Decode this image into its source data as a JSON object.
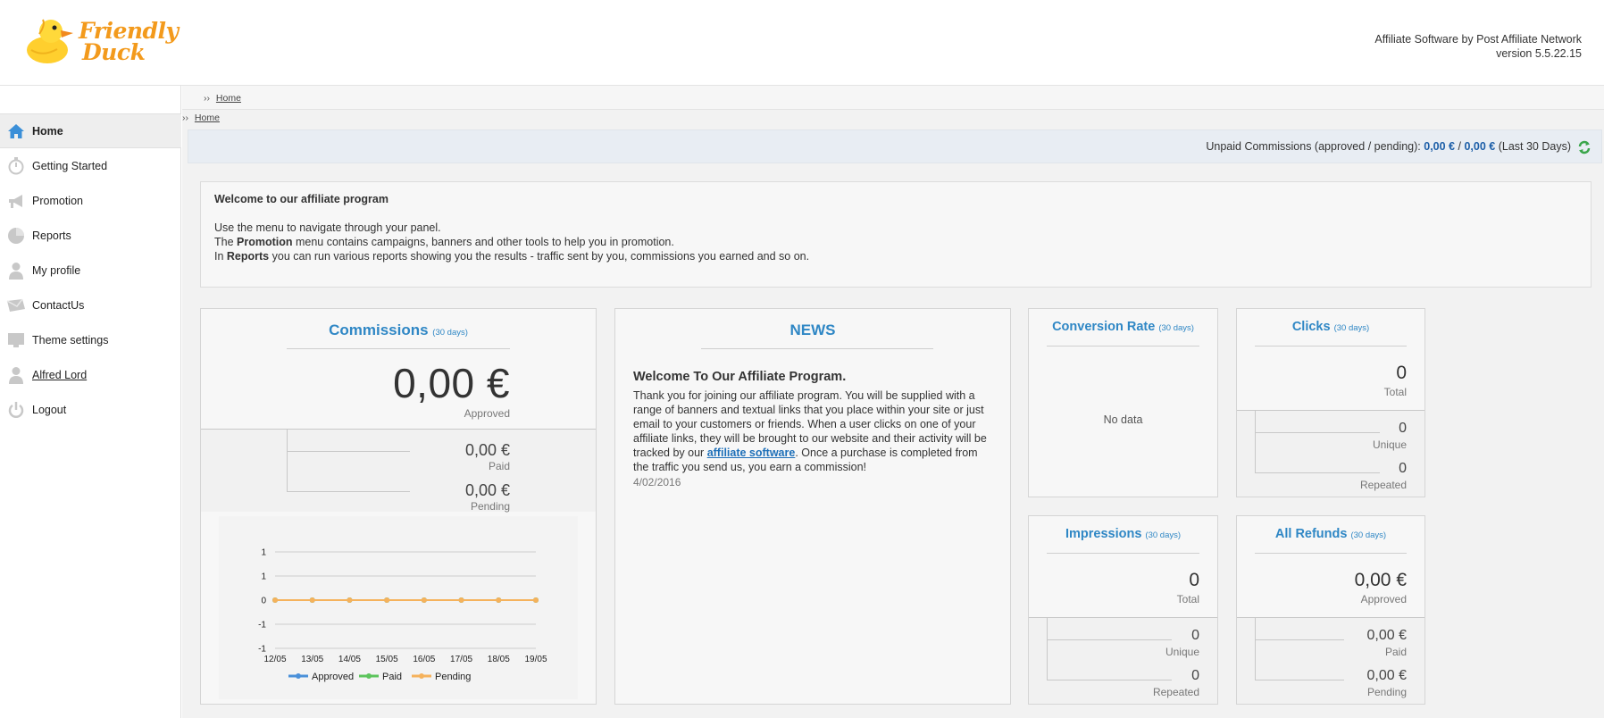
{
  "brand": {
    "logo_line1": "Friendly",
    "logo_line2": "Duck"
  },
  "header": {
    "software": "Affiliate Software by Post Affiliate Network",
    "version": "version 5.5.22.15"
  },
  "sidebar": {
    "items": [
      {
        "label": "Home",
        "icon": "home-icon",
        "active": true
      },
      {
        "label": "Getting Started",
        "icon": "stopwatch-icon"
      },
      {
        "label": "Promotion",
        "icon": "megaphone-icon"
      },
      {
        "label": "Reports",
        "icon": "pie-chart-icon"
      },
      {
        "label": "My profile",
        "icon": "user-icon"
      },
      {
        "label": "ContactUs",
        "icon": "envelope-icon"
      },
      {
        "label": "Theme settings",
        "icon": "monitor-icon"
      },
      {
        "label": "Alfred Lord",
        "icon": "user-icon"
      },
      {
        "label": "Logout",
        "icon": "power-icon"
      }
    ]
  },
  "breadcrumb": {
    "sep": "››",
    "home": "Home"
  },
  "unpaid": {
    "prefix": "Unpaid Commissions (approved / pending):",
    "approved": "0,00 €",
    "slash": "/",
    "pending": "0,00 €",
    "suffix": "(Last 30 Days)"
  },
  "welcome": {
    "title": "Welcome to our affiliate program",
    "line1": "Use the menu to navigate through your panel.",
    "line2_a": "The ",
    "line2_b": "Promotion",
    "line2_c": " menu contains campaigns, banners and other tools to help you in promotion.",
    "line3_a": "In ",
    "line3_b": "Reports",
    "line3_c": " you can run various reports showing you the results - traffic sent by you, commissions you earned and so on."
  },
  "commissions": {
    "title": "Commissions",
    "period": "(30 days)",
    "approved_value": "0,00 €",
    "approved_label": "Approved",
    "paid_value": "0,00 €",
    "paid_label": "Paid",
    "pending_value": "0,00 €",
    "pending_label": "Pending"
  },
  "news": {
    "title": "NEWS",
    "headline": "Welcome To Our Affiliate Program.",
    "body_a": "Thank you for joining our affiliate program. You will be supplied with a range of banners and textual links that you place within your site or just email to your customers or friends. When a user clicks on one of your affiliate links, they will be brought to our website and their activity will be tracked by our ",
    "link": "affiliate software",
    "body_b": ". Once a purchase is completed from the traffic you send us, you earn a commission!",
    "date": "4/02/2016"
  },
  "conversion": {
    "title": "Conversion Rate",
    "period": "(30 days)",
    "nodata": "No data"
  },
  "clicks": {
    "title": "Clicks",
    "period": "(30 days)",
    "total": "0",
    "total_label": "Total",
    "unique": "0",
    "unique_label": "Unique",
    "repeated": "0",
    "repeated_label": "Repeated"
  },
  "impressions": {
    "title": "Impressions",
    "period": "(30 days)",
    "total": "0",
    "total_label": "Total",
    "unique": "0",
    "unique_label": "Unique",
    "repeated": "0",
    "repeated_label": "Repeated"
  },
  "refunds": {
    "title": "All Refunds",
    "period": "(30 days)",
    "approved": "0,00 €",
    "approved_label": "Approved",
    "paid": "0,00 €",
    "paid_label": "Paid",
    "pending": "0,00 €",
    "pending_label": "Pending"
  },
  "colors": {
    "accent": "#2f87c5",
    "logo": "#f39a1c",
    "approved": "#4a90d9",
    "paid": "#5cc45c",
    "pending": "#f5b25c"
  },
  "chart_data": {
    "type": "line",
    "x": [
      "12/05",
      "13/05",
      "14/05",
      "15/05",
      "16/05",
      "17/05",
      "18/05",
      "19/05"
    ],
    "y_ticks": [
      "1",
      "1",
      "0",
      "-1",
      "-1"
    ],
    "ylim": [
      -1,
      1
    ],
    "series": [
      {
        "name": "Approved",
        "values": [
          0,
          0,
          0,
          0,
          0,
          0,
          0,
          0
        ],
        "color": "#4a90d9"
      },
      {
        "name": "Paid",
        "values": [
          0,
          0,
          0,
          0,
          0,
          0,
          0,
          0
        ],
        "color": "#5cc45c"
      },
      {
        "name": "Pending",
        "values": [
          0,
          0,
          0,
          0,
          0,
          0,
          0,
          0
        ],
        "color": "#f5b25c"
      }
    ],
    "legend_position": "bottom",
    "grid": true
  }
}
